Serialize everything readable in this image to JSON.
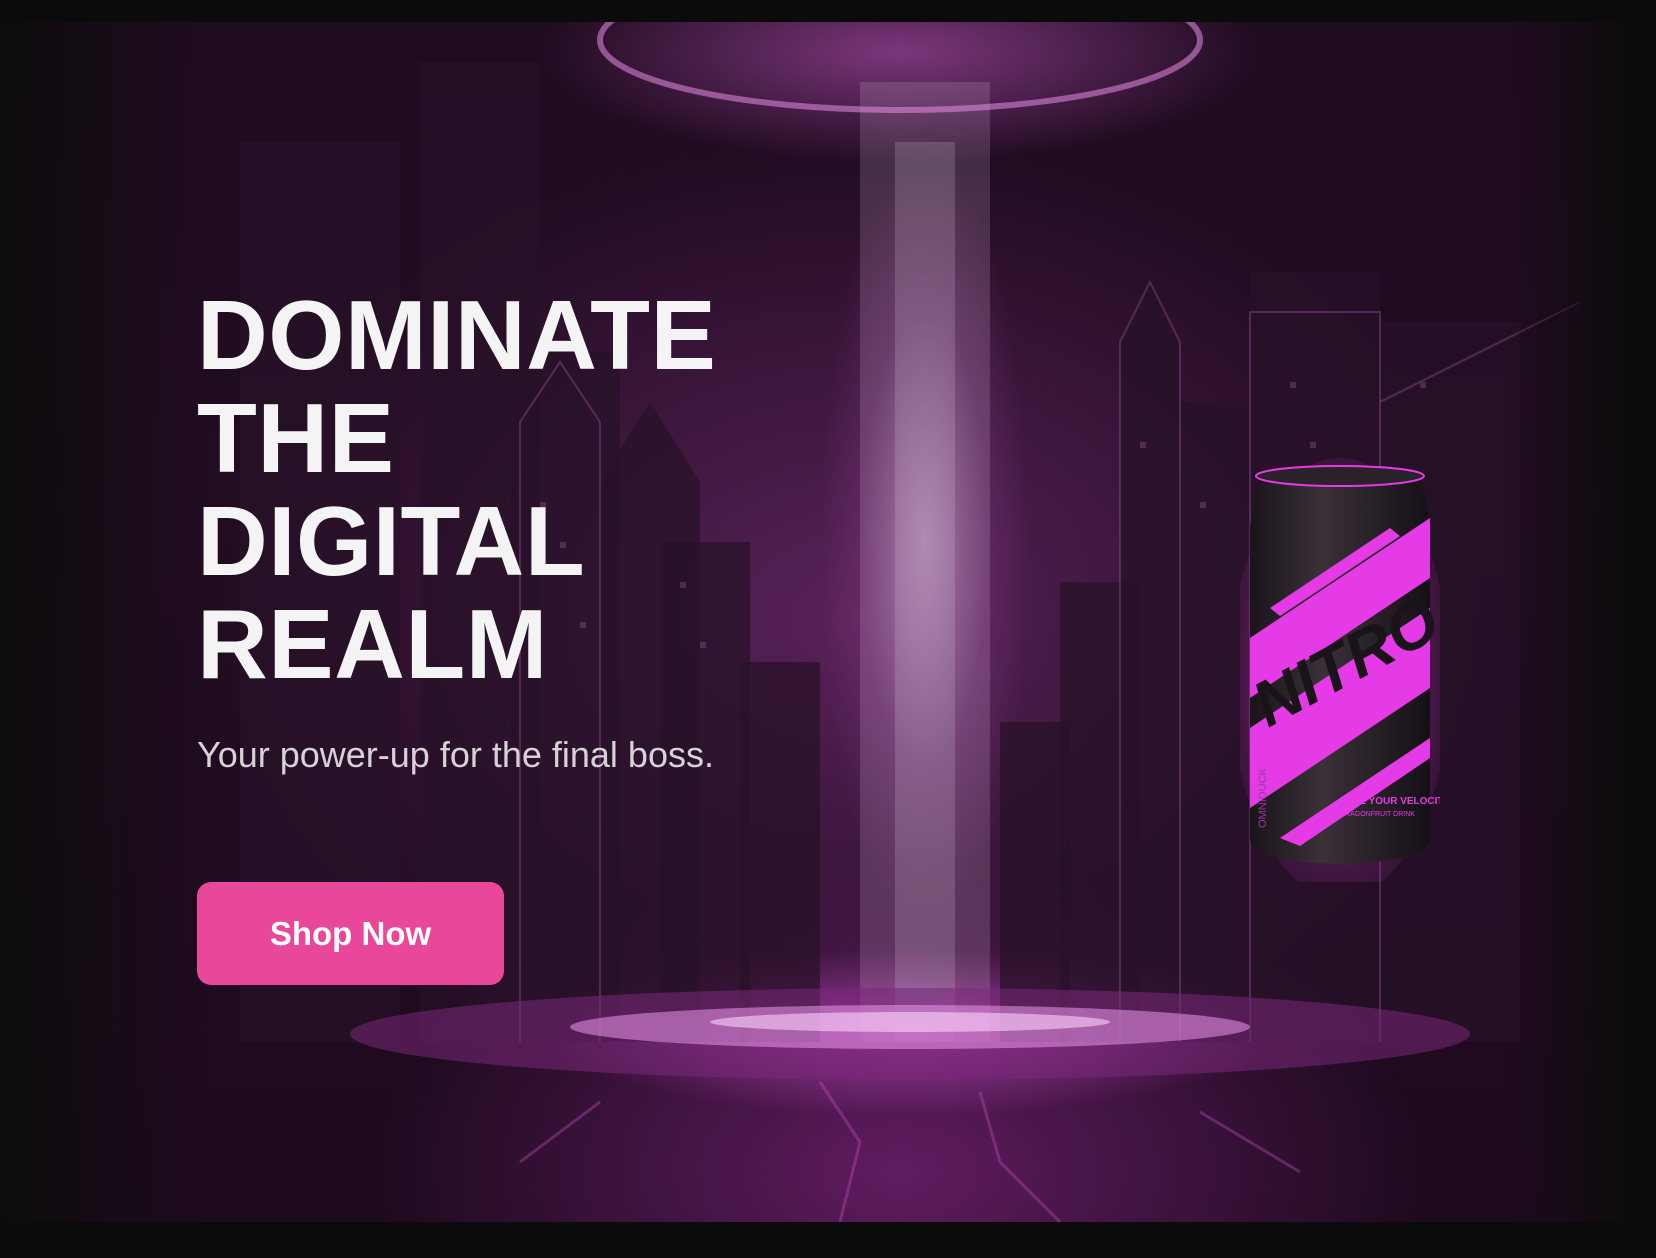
{
  "hero": {
    "headline_lines": [
      "DOMINATE",
      "THE",
      "DIGITAL",
      "REALM"
    ],
    "subtitle": "Your power-up for the final boss.",
    "cta_label": "Shop Now"
  },
  "product": {
    "brand_name": "NITRO",
    "side_text": "OMNIDUCK",
    "tagline": "FUEL YOUR VELOCITY",
    "flavor": "DRAGONFRUIT DRINK"
  },
  "colors": {
    "accent": "#e9489a",
    "can_pink": "#e43be6",
    "background": "#0b0b0c"
  }
}
